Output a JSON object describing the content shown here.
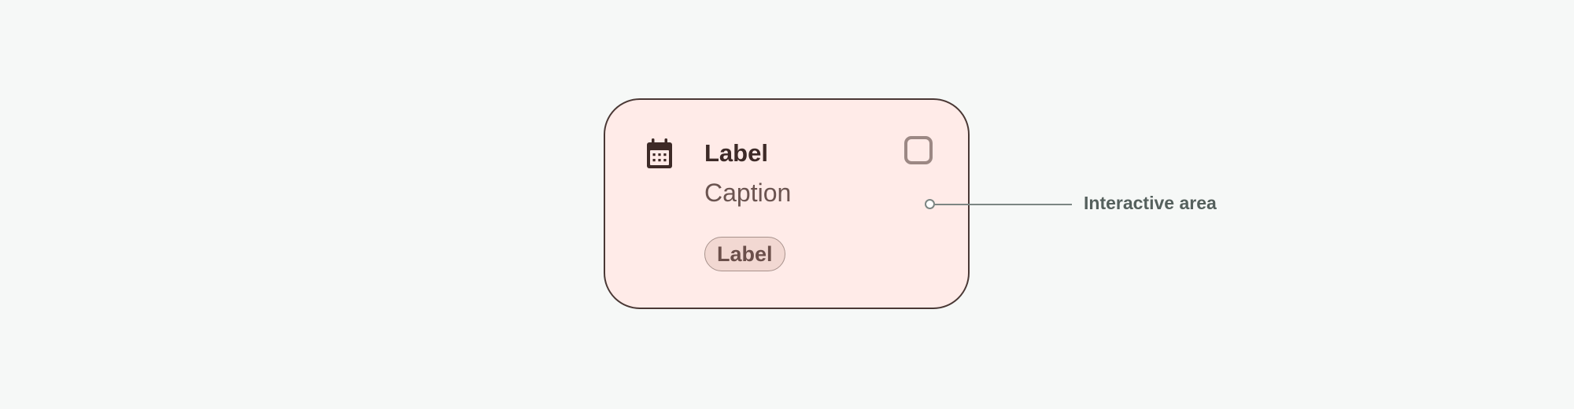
{
  "card": {
    "label": "Label",
    "caption": "Caption",
    "chip_label": "Label",
    "leading_icon": "calendar-icon",
    "trailing_control": "checkbox",
    "checkbox_checked": false
  },
  "annotation": {
    "text": "Interactive area"
  },
  "colors": {
    "background": "#f6f8f7",
    "card_fill": "#ffebe8",
    "card_border": "#4a3835",
    "chip_fill": "#f2d8d2",
    "label_text": "#3d2a27",
    "caption_text": "#6b5450",
    "checkbox_border": "#9c8884",
    "annotation_text": "#55605d"
  }
}
